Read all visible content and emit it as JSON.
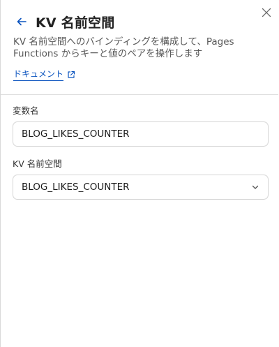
{
  "panel": {
    "title": "KV 名前空間",
    "description": "KV 名前空間へのバインディングを構成して、Pages Functions からキーと値のペアを操作します",
    "doc_link_label": "ドキュメント",
    "icons": {
      "back": "arrow-left-icon",
      "close": "close-icon",
      "external": "external-link-icon",
      "dropdown": "chevron-down-icon"
    }
  },
  "form": {
    "variable_name": {
      "label": "変数名",
      "value": "BLOG_LIKES_COUNTER"
    },
    "kv_namespace": {
      "label": "KV 名前空間",
      "selected": "BLOG_LIKES_COUNTER"
    }
  },
  "colors": {
    "link": "#0a53be",
    "border": "#d5d5d5",
    "divider": "#dedede"
  }
}
